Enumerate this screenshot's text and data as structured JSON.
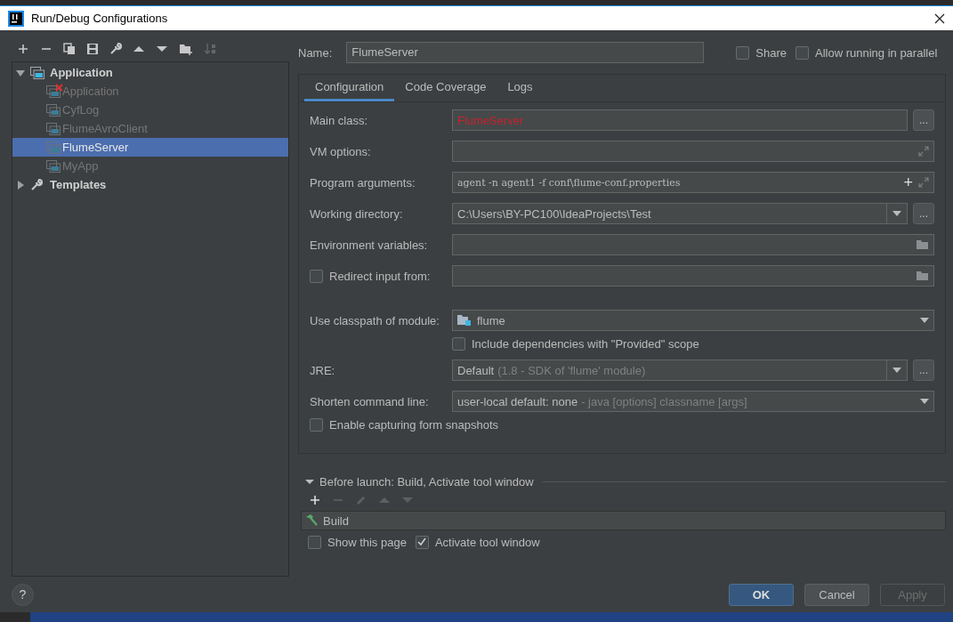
{
  "window": {
    "title": "Run/Debug Configurations"
  },
  "tree": [
    {
      "label": "Application",
      "kind": "folder",
      "expanded": true,
      "children": [
        {
          "label": "Application",
          "error": true,
          "selected": false
        },
        {
          "label": "CyfLog",
          "error": false,
          "selected": false
        },
        {
          "label": "FlumeAvroClient",
          "error": false,
          "selected": false
        },
        {
          "label": "FlumeServer",
          "error": false,
          "selected": true
        },
        {
          "label": "MyApp",
          "error": false,
          "selected": false
        }
      ]
    },
    {
      "label": "Templates",
      "kind": "templates",
      "expanded": false
    }
  ],
  "name_field": {
    "label": "Name:",
    "value": "FlumeServer"
  },
  "options": [
    {
      "label": "Share",
      "checked": false
    },
    {
      "label": "Allow running in parallel",
      "checked": false
    }
  ],
  "tabs": [
    {
      "label": "Configuration",
      "selected": true
    },
    {
      "label": "Code Coverage",
      "selected": false
    },
    {
      "label": "Logs",
      "selected": false
    }
  ],
  "rows": [
    {
      "kind": "input",
      "label": "Main class:",
      "value": "FlumeServer",
      "error": true,
      "browse": "..."
    },
    {
      "kind": "expand",
      "label": "VM options:"
    },
    {
      "kind": "expand",
      "label": "Program arguments:",
      "value": "agent -n agent1 -f conf\\flume-conf.properties",
      "mono": true,
      "plus": "+"
    },
    {
      "kind": "combo",
      "label": "Working directory:",
      "value": "C:\\Users\\BY-PC100\\IdeaProjects\\Test",
      "browse": "..."
    },
    {
      "kind": "folder",
      "label": "Environment variables:"
    },
    {
      "kind": "folder",
      "label": "Redirect input from:",
      "checked": false
    },
    {
      "kind": "module",
      "label": "Use classpath of module:",
      "value": "flume"
    },
    {
      "kind": "checkbox",
      "label": "Include dependencies with \"Provided\" scope",
      "checked": false
    },
    {
      "kind": "combo",
      "label": "JRE:",
      "value": "Default",
      "hint": "(1.8 - SDK of 'flume' module)",
      "browse": "..."
    },
    {
      "kind": "dropdown",
      "label": "Shorten command line:",
      "value": "user-local default: none",
      "hint": "- java [options] classname [args]"
    },
    {
      "kind": "checkbox_left",
      "label": "Enable capturing form snapshots",
      "checked": false
    }
  ],
  "before_launch": {
    "title": "Before launch: Build, Activate tool window",
    "expanded": true,
    "tasks": [
      {
        "label": "Build"
      }
    ],
    "options": [
      {
        "label": "Show this page",
        "checked": false
      },
      {
        "label": "Activate tool window",
        "checked": true
      }
    ]
  },
  "help": "?",
  "buttons": [
    {
      "label": "OK",
      "kind": "primary"
    },
    {
      "label": "Cancel",
      "kind": "normal"
    },
    {
      "label": "Apply",
      "kind": "disabled"
    }
  ]
}
